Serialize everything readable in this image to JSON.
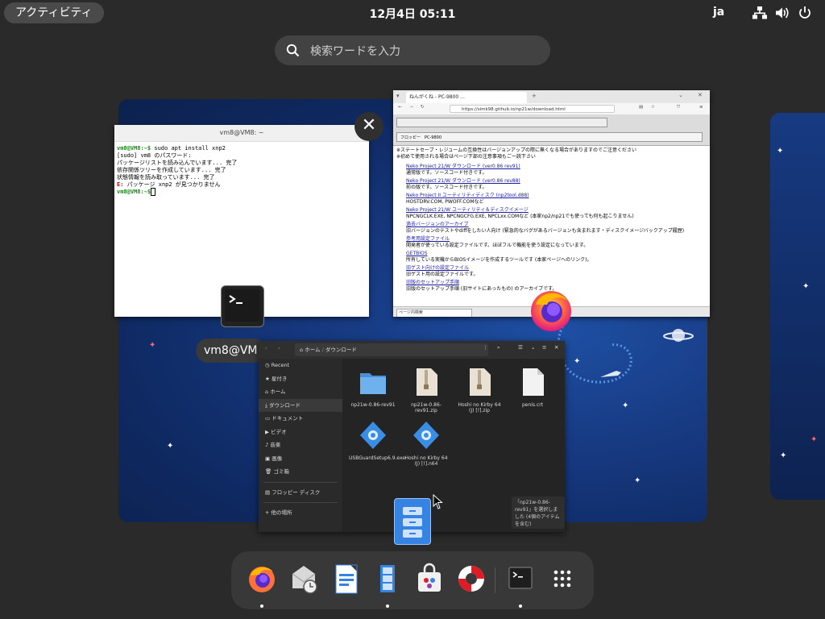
{
  "topbar": {
    "activities": "アクティビティ",
    "clock": "12月4日  05:11",
    "language": "ja",
    "icons": [
      "network-icon",
      "volume-icon",
      "power-icon"
    ]
  },
  "search": {
    "placeholder": "検索ワードを入力"
  },
  "terminal": {
    "title": "vm8@VM8: ~",
    "label": "vm8@VM",
    "prompt1": "vm8@VM8:~$",
    "cmd1": " sudo apt install xnp2",
    "lines": [
      "[sudo] vm8 のパスワード:",
      "パッケージリストを読み込んでいます... 完了",
      "依存関係ツリーを作成しています... 完了",
      "状態情報を読み取っています... 完了"
    ],
    "error_prefix": "E:",
    "error_text": " パッケージ xnp2 が見つかりません",
    "prompt2": "vm8@VM8:~$",
    "cursor": " "
  },
  "firefox": {
    "tab_title": "ねんがくね - PC-9800 ...",
    "tab2": "Neko Project 21/W",
    "url": "https://simk98.github.io/np21w/download.html",
    "emu_status": "フロッピー　PC-9800",
    "intro1": "※ステートセーブ・レジュームの互換性はバージョンアップの際に無くなる場合がありますのでご注意ください",
    "intro2": "※初めて使用される場合はページ下部の注意事項もご一読下さい",
    "items": [
      {
        "link": "Neko Project 21/W ダウンロード (ver0.86 rev91)",
        "note": "通常版です。ソースコード付きです。"
      },
      {
        "link": "Neko Project 21/W ダウンロード (ver0.86 rev88)",
        "note": "前の版です。ソースコード付きです。"
      },
      {
        "link": "Neko Project II ユーティリティディスク (np2tool.d88)",
        "note": "HOSTDRV.COM, PWOFF.COMなど"
      },
      {
        "link": "Neko Project 21/W ユーティリティ＆ディスクイメージ",
        "note": "NPCNGCLK.EXE, NPCNGCFG.EXE, NPCLxx.COMなど (本家np2/np21でも使っても何も起こりません)"
      },
      {
        "link": "過去バージョンのアーカイブ",
        "note": "旧バージョンのテストやdiffをしたい人向け (緊急的なバグがあるバージョンも含まれます・ディスクイメージバックアップ履歴)"
      },
      {
        "link": "参考用設定ファイル",
        "note": "開発者が使っている設定ファイルです。ほぼフルで機能を使う設定になっています。"
      },
      {
        "link": "GETBIOS",
        "note": "所有している実機からBIOSイメージを作成するツールです (本家ページへのリンク)。"
      },
      {
        "link": "旧ゲスト向けの設定ファイル",
        "note": "旧ゲスト用の設定ファイルです。"
      },
      {
        "link": "旧版のセットアップ手順",
        "note": "旧版のセットアップ手順 (旧サイトにあったもの) のアーカイブです。"
      }
    ],
    "find_placeholder": "ページ内検索"
  },
  "files": {
    "path_home": "ホーム",
    "path_current": "ダウンロード",
    "sidebar": [
      {
        "icon": "clock-icon",
        "label": "Recent"
      },
      {
        "icon": "star-icon",
        "label": "星付き"
      },
      {
        "icon": "home-icon",
        "label": "ホーム"
      },
      {
        "icon": "download-icon",
        "label": "ダウンロード"
      },
      {
        "icon": "document-icon",
        "label": "ドキュメント"
      },
      {
        "icon": "video-icon",
        "label": "ビデオ"
      },
      {
        "icon": "music-icon",
        "label": "音楽"
      },
      {
        "icon": "picture-icon",
        "label": "画像"
      },
      {
        "icon": "trash-icon",
        "label": "ゴミ箱"
      },
      {
        "icon": "floppy-icon",
        "label": "フロッピー ディスク"
      },
      {
        "icon": "plus-icon",
        "label": "他の場所"
      }
    ],
    "items": [
      {
        "type": "folder",
        "name": "np21w-0.86-rev91"
      },
      {
        "type": "zip",
        "name": "np21w-0.86-rev91.zip"
      },
      {
        "type": "zip",
        "name": "Hoshi no Kirby 64 (J) [!].zip"
      },
      {
        "type": "file",
        "name": "penis.crt"
      },
      {
        "type": "exe",
        "name": "USBGuardSetup6.9.exe"
      },
      {
        "type": "exe",
        "name": "Hoshi no Kirby 64 (J) [!].n64"
      }
    ],
    "status": "「np21w-0.86-rev91」を選択しました (4個のアイテムを含む)"
  },
  "dash": {
    "items": [
      {
        "name": "firefox",
        "running": true
      },
      {
        "name": "evolution",
        "running": false
      },
      {
        "name": "writer",
        "running": false
      },
      {
        "name": "files",
        "running": true
      },
      {
        "name": "software",
        "running": false
      },
      {
        "name": "help",
        "running": false
      },
      {
        "name": "terminal",
        "running": true
      },
      {
        "name": "app-grid",
        "running": false
      }
    ]
  },
  "colors": {
    "panel": "#383838",
    "accent": "#3584e4",
    "workspace": "#173a82",
    "firefox_orange": "#ff9400"
  }
}
